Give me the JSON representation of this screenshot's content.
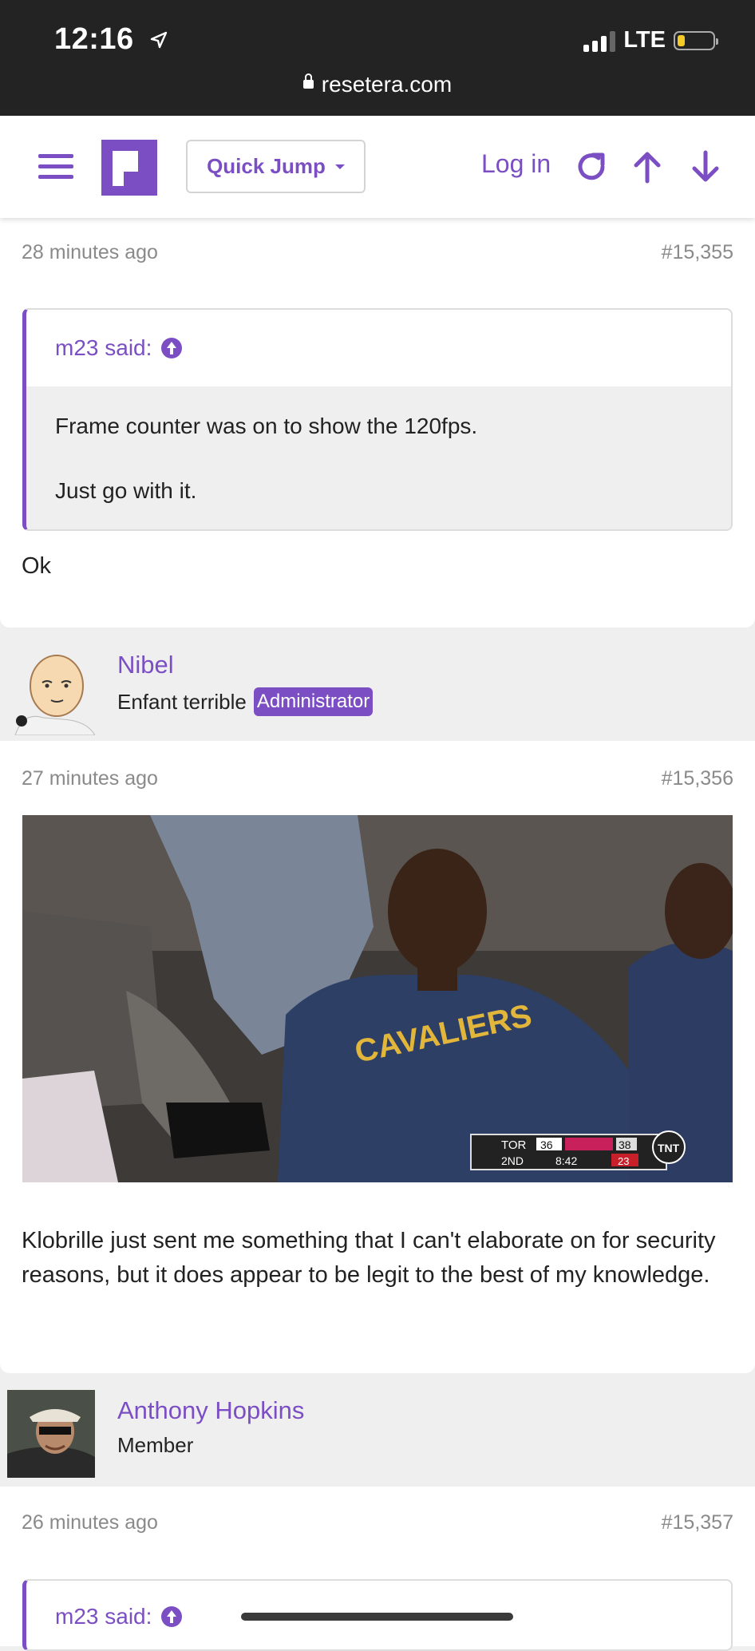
{
  "status_bar": {
    "time": "12:16",
    "network": "LTE",
    "battery_level": 0.2
  },
  "browser": {
    "domain": "resetera.com"
  },
  "header": {
    "quick_jump_label": "Quick Jump",
    "login_label": "Log in"
  },
  "posts": [
    {
      "time": "28 minutes ago",
      "number": "#15,355",
      "quote": {
        "author": "m23 said:",
        "lines": [
          "Frame counter was on to show the 120fps.",
          "Just go with it."
        ]
      },
      "text": "Ok"
    },
    {
      "user": {
        "name": "Nibel",
        "title": "Enfant terrible",
        "badge": "Administrator"
      },
      "time": "27 minutes ago",
      "number": "#15,356",
      "image": {
        "jersey_text": "CAVALIERS",
        "scoreboard": {
          "team_a": "TOR",
          "score_a": "36",
          "score_b": "38",
          "period": "2ND",
          "clock": "8:42",
          "shot_clock": "23",
          "network": "TNT"
        }
      },
      "text": "Klobrille just sent me something that I can't elaborate on for security reasons, but it does appear to be legit to the best of my knowledge."
    },
    {
      "user": {
        "name": "Anthony Hopkins",
        "title": "Member"
      },
      "time": "26 minutes ago",
      "number": "#15,357",
      "quote": {
        "author": "m23 said:"
      }
    }
  ],
  "colors": {
    "accent": "#7b4fc3",
    "status_bar": "#232323",
    "page_bg": "#efeff0"
  }
}
